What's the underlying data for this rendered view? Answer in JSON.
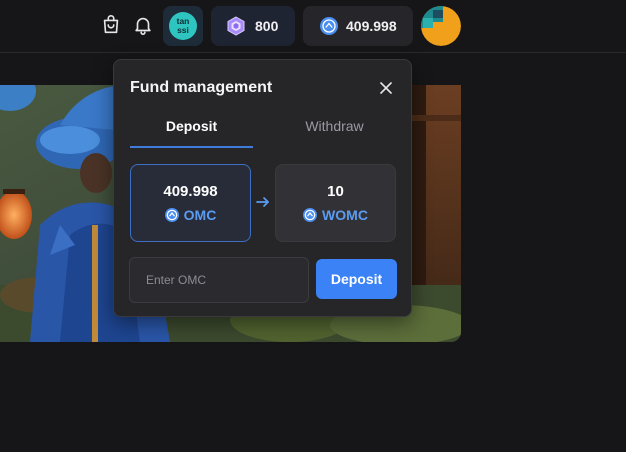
{
  "header": {
    "icons": [
      "shopping-bag-icon",
      "bell-icon",
      "tanssi-logo-icon",
      "gem-icon",
      "omc-coin-icon"
    ],
    "tanssi_logo": {
      "line1": "tan",
      "line2": "ssi"
    },
    "gems": "800",
    "balance": "409.998"
  },
  "popup": {
    "title": "Fund management",
    "tabs": [
      {
        "label": "Deposit",
        "active": true
      },
      {
        "label": "Withdraw",
        "active": false
      }
    ],
    "from": {
      "amount": "409.998",
      "token": "OMC"
    },
    "to": {
      "amount": "10",
      "token": "WOMC"
    },
    "input": {
      "placeholder": "Enter OMC",
      "value": ""
    },
    "submit_label": "Deposit"
  },
  "colors": {
    "accent": "#3b82f6",
    "token_blue": "#5b9cf2",
    "background": "#161618",
    "popup_bg": "#262629"
  }
}
